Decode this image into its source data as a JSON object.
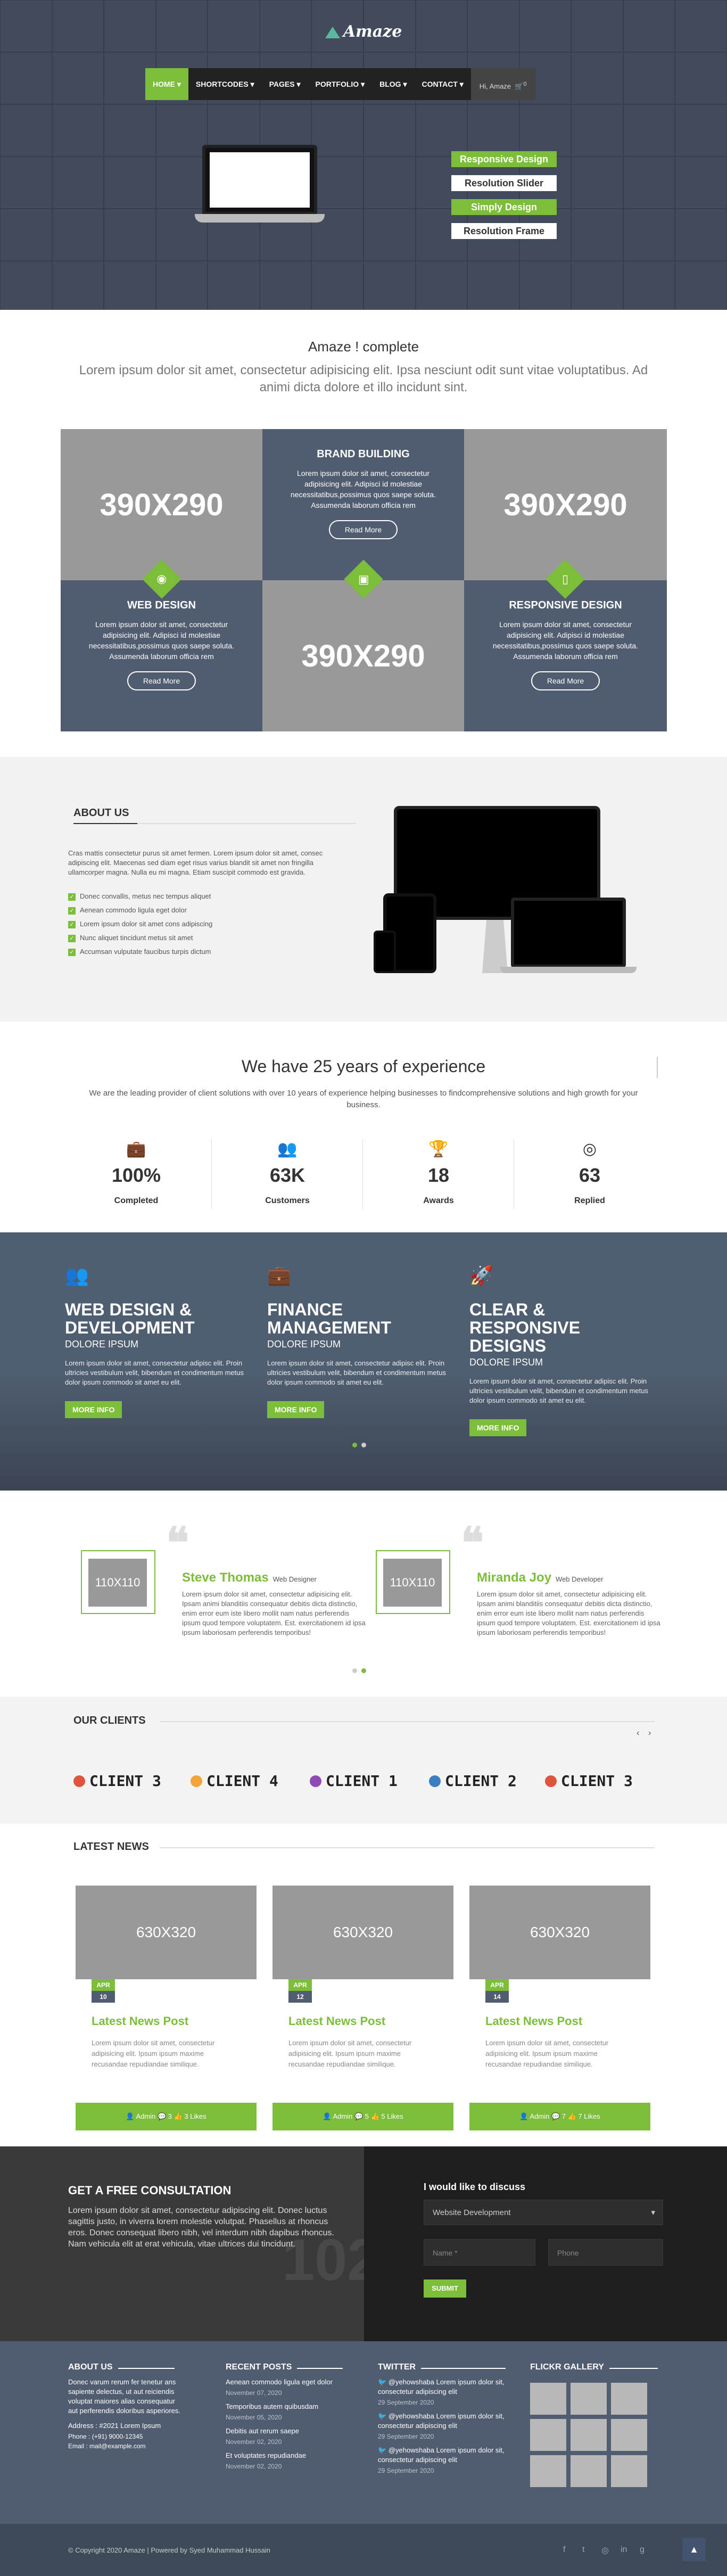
{
  "header": {
    "logo": "Amaze",
    "nav": [
      "HOME ▾",
      "SHORTCODES ▾",
      "PAGES ▾",
      "PORTFOLIO ▾",
      "BLOG ▾",
      "CONTACT ▾"
    ],
    "search_label": "Hi, Amaze",
    "cart_count": "0",
    "hero_buttons": [
      "Responsive Design",
      "Resolution Slider",
      "Simply Design",
      "Resolution Frame"
    ]
  },
  "intro": {
    "title": "Amaze ! complete",
    "text": "Lorem ipsum dolor sit amet, consectetur adipisicing elit. Ipsa nesciunt odit sunt vitae voluptatibus. Ad animi dicta dolore et illo incidunt sint."
  },
  "features": {
    "placeholder": "390X290",
    "brand": {
      "title": "BRAND BUILDING",
      "text": "Lorem ipsum dolor sit amet, consectetur adipisicing elit. Adipisci id molestiae necessitatibus,possimus quos saepe soluta. Assumenda laborum officia rem",
      "button": "Read More"
    },
    "web": {
      "title": "WEB DESIGN",
      "text": "Lorem ipsum dolor sit amet, consectetur adipisicing elit. Adipisci id molestiae necessitatibus,possimus quos saepe soluta. Assumenda laborum officia rem",
      "button": "Read More"
    },
    "responsive": {
      "title": "RESPONSIVE DESIGN",
      "text": "Lorem ipsum dolor sit amet, consectetur adipisicing elit. Adipisci id molestiae necessitatibus,possimus quos saepe soluta. Assumenda laborum officia rem",
      "button": "Read More"
    }
  },
  "about": {
    "title": "ABOUT US",
    "text": "Cras mattis consectetur purus sit amet fermen. Lorem ipsum dolor sit amet, consec adipiscing elit. Maecenas sed diam eget risus varius blandit sit amet non fringilla ullamcorper magna. Nulla eu mi magna. Etiam suscipit commodo est gravida.",
    "list": [
      "Donec convallis, metus nec tempus aliquet",
      "Aenean commodo ligula eget dolor",
      "Lorem ipsum dolor sit amet cons adipiscing",
      "Nunc aliquet tincidunt metus sit amet",
      "Accumsan vulputate faucibus turpis dictum"
    ]
  },
  "experience": {
    "title": "We have 25 years of experience",
    "text": "We are the leading provider of client solutions with over 10 years of experience helping businesses to findcomprehensive solutions and high growth for your business.",
    "stats": [
      {
        "icon": "💼",
        "value": "100%",
        "label": "Completed"
      },
      {
        "icon": "👥",
        "value": "63K",
        "label": "Customers"
      },
      {
        "icon": "🏆",
        "value": "18",
        "label": "Awards"
      },
      {
        "icon": "◎",
        "value": "63",
        "label": "Replied"
      }
    ]
  },
  "services": [
    {
      "icon": "👥",
      "title": "WEB DESIGN & DEVELOPMENT",
      "sub": "DOLORE IPSUM",
      "text": "Lorem ipsum dolor sit amet, consectetur adipisc elit. Proin ultricies vestibulum velit, bibendum et condimentum metus dolor ipsum commodo sit amet eu elit.",
      "button": "MORE INFO"
    },
    {
      "icon": "💼",
      "title": "FINANCE MANAGEMENT",
      "sub": "DOLORE IPSUM",
      "text": "Lorem ipsum dolor sit amet, consectetur adipisc elit. Proin ultricies vestibulum velit, bibendum et condimentum metus dolor ipsum commodo sit amet eu elit.",
      "button": "MORE INFO"
    },
    {
      "icon": "🚀",
      "title": "CLEAR & RESPONSIVE DESIGNS",
      "sub": "DOLORE IPSUM",
      "text": "Lorem ipsum dolor sit amet, consectetur adipisc elit. Proin ultricies vestibulum velit, bibendum et condimentum metus dolor ipsum commodo sit amet eu elit.",
      "button": "MORE INFO"
    }
  ],
  "testimonials": [
    {
      "img": "110X110",
      "name": "Steve Thomas",
      "role": "Web Designer",
      "text": "Lorem ipsum dolor sit amet, consectetur adipisicing elit. Ipsam animi blanditiis consequatur debitis dicta distinctio, enim error eum iste libero mollit nam natus perferendis ipsum quod tempore voluptatem. Est. exercitationem id ipsa ipsum laboriosam perferendis temporibus!"
    },
    {
      "img": "110X110",
      "name": "Miranda Joy",
      "role": "Web Developer",
      "text": "Lorem ipsum dolor sit amet, consectetur adipisicing elit. Ipsam animi blanditiis consequatur debitis dicta distinctio, enim error eum iste libero mollit nam natus perferendis ipsum quod tempore voluptatem. Est. exercitationem id ipsa ipsum laboriosam perferendis temporibus!"
    }
  ],
  "clients": {
    "title": "OUR CLIENTS",
    "logos": [
      "CLIENT 3",
      "CLIENT 4",
      "CLIENT 1",
      "CLIENT 2",
      "CLIENT 3"
    ]
  },
  "news": {
    "title": "LATEST NEWS",
    "posts": [
      {
        "img": "630X320",
        "month": "APR",
        "day": "10",
        "title": "Latest News Post",
        "text": "Lorem ipsum dolor sit amet, consectetur adipisicing elit. Ipsum ipsum maxime recusandae repudiandae similique.",
        "meta": "👤 Admin  💬 3  👍 3 Likes"
      },
      {
        "img": "630X320",
        "month": "APR",
        "day": "12",
        "title": "Latest News Post",
        "text": "Lorem ipsum dolor sit amet, consectetur adipisicing elit. Ipsum ipsum maxime recusandae repudiandae similique.",
        "meta": "👤 Admin  💬 5  👍 5 Likes"
      },
      {
        "img": "630X320",
        "month": "APR",
        "day": "14",
        "title": "Latest News Post",
        "text": "Lorem ipsum dolor sit amet, consectetur adipisicing elit. Ipsum ipsum maxime recusandae repudiandae similique.",
        "meta": "👤 Admin  💬 7  👍 7 Likes"
      }
    ]
  },
  "consult": {
    "title": "GET A FREE CONSULTATION",
    "text": "Lorem ipsum dolor sit amet, consectetur adipiscing elit. Donec luctus sagittis justo, in viverra lorem molestie volutpat. Phasellus at rhoncus eros. Donec consequat libero nibh, vel interdum nibh dapibus rhoncus. Nam vehicula elit at erat vehicula, vitae ultrices dui tincidunt.",
    "big": "102",
    "form_title": "I would like to discuss",
    "select": "Website Development",
    "name_placeholder": "Name *",
    "phone_placeholder": "Phone",
    "submit": "SUBMIT"
  },
  "footer": {
    "about": {
      "title": "ABOUT US",
      "text": "Donec varum rerum fer tenetur ans sapiente delectus, ut aut reiciendis voluptat maiores alias consequatur aut perferendis doloribus asperiores.",
      "address": "Address :  #2021 Lorem Ipsum",
      "phone": "Phone :  (+91) 9000-12345",
      "email": "Email :  mail@example.com"
    },
    "recent": {
      "title": "RECENT POSTS",
      "posts": [
        {
          "t": "Aenean commodo ligula eget dolor",
          "d": "November 07, 2020"
        },
        {
          "t": "Temporibus autem quibusdam",
          "d": "November 05, 2020"
        },
        {
          "t": "Debitis aut rerum saepe",
          "d": "November 02, 2020"
        },
        {
          "t": "Et voluptates repudiandae",
          "d": "November 02, 2020"
        }
      ]
    },
    "twitter": {
      "title": "TWITTER",
      "tweets": [
        {
          "t": "@yehowshaba Lorem ipsum dolor sit, consectetur adipiscing elit",
          "d": "29 September 2020"
        },
        {
          "t": "@yehowshaba Lorem ipsum dolor sit, consectetur adipiscing elit",
          "d": "29 September 2020"
        },
        {
          "t": "@yehowshaba Lorem ipsum dolor sit, consectetur adipiscing elit",
          "d": "29 September 2020"
        }
      ]
    },
    "flickr": {
      "title": "FLICKR GALLERY"
    },
    "copyright": "© Copyright 2020 Amaze | Powered by Syed Muhammad Hussain",
    "social": [
      "f",
      "t",
      "◎",
      "in",
      "g"
    ],
    "top": "▲"
  },
  "colors": {
    "accent": "#7cbd3a",
    "slate": "#505d71",
    "dark": "#222222"
  }
}
